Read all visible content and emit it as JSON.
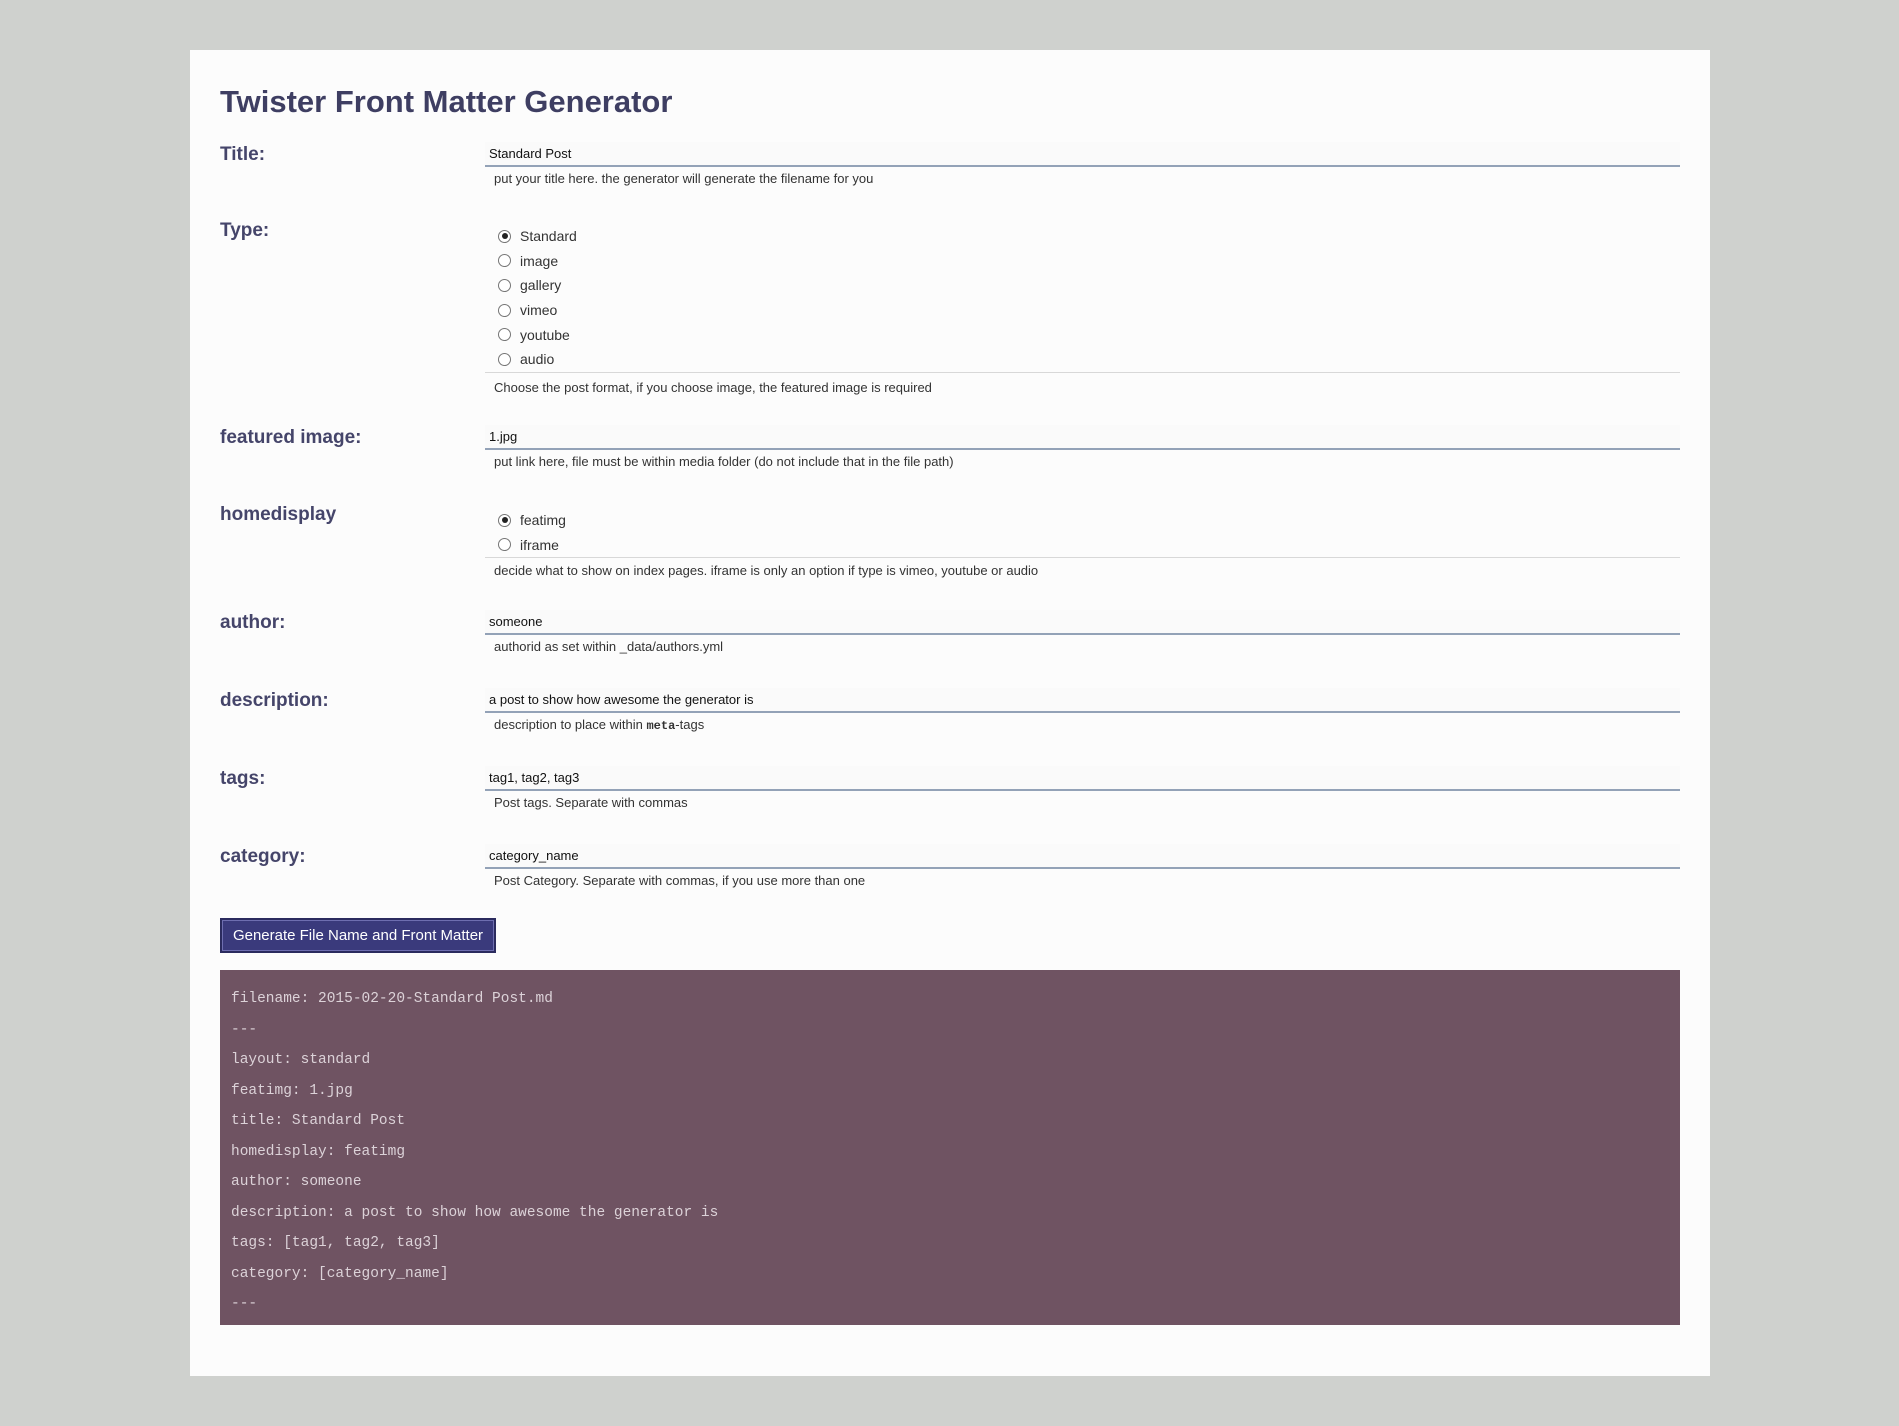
{
  "page_title": "Twister Front Matter Generator",
  "fields": {
    "title": {
      "label": "Title:",
      "value": "Standard Post",
      "help": "put your title here. the generator will generate the filename for you"
    },
    "type": {
      "label": "Type:",
      "options": [
        "Standard",
        "image",
        "gallery",
        "vimeo",
        "youtube",
        "audio"
      ],
      "selected": "Standard",
      "help": "Choose the post format, if you choose image, the featured image is required"
    },
    "featured_image": {
      "label": "featured image:",
      "value": "1.jpg",
      "help": "put link here, file must be within media folder (do not include that in the file path)"
    },
    "homedisplay": {
      "label": "homedisplay",
      "options": [
        "featimg",
        "iframe"
      ],
      "selected": "featimg",
      "help": "decide what to show on index pages. iframe is only an option if type is vimeo, youtube or audio"
    },
    "author": {
      "label": "author:",
      "value": "someone",
      "help": "authorid as set within _data/authors.yml"
    },
    "description": {
      "label": "description:",
      "value": "a post to show how awesome the generator is",
      "help_prefix": "description to place within ",
      "help_code": "meta",
      "help_suffix": "-tags"
    },
    "tags": {
      "label": "tags:",
      "value": "tag1, tag2, tag3",
      "help": "Post tags. Separate with commas"
    },
    "category": {
      "label": "category:",
      "value": "category_name",
      "help": "Post Category. Separate with commas, if you use more than one"
    }
  },
  "generate_button_label": "Generate File Name and Front Matter",
  "output_lines": [
    "filename: 2015-02-20-Standard Post.md",
    "---",
    "layout: standard",
    "featimg: 1.jpg",
    "title: Standard Post",
    "homedisplay: featimg",
    "author: someone",
    "description: a post to show how awesome the generator is",
    "tags: [tag1, tag2, tag3]",
    "category: [category_name]",
    "---"
  ],
  "colors": {
    "page_background": "#cfd1ce",
    "panel_background": "#fcfcfc",
    "heading": "#3e3e62",
    "button_background": "#3a3a7c",
    "output_background": "#6f5362",
    "output_text": "#dcd2d8"
  }
}
